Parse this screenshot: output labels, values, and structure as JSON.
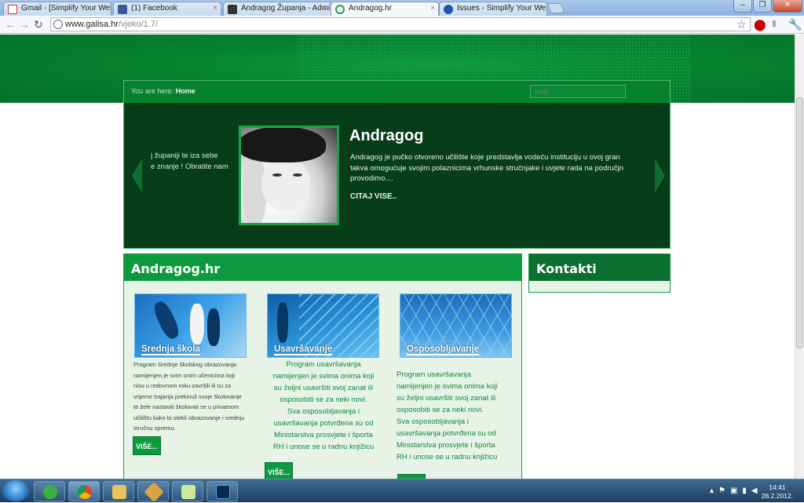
{
  "browser": {
    "tabs": [
      {
        "label": "Gmail - [Simplify Your Web",
        "icon": "gmail-icon",
        "color": "#d93025"
      },
      {
        "label": "(1) Facebook",
        "icon": "facebook-icon",
        "color": "#3b5998"
      },
      {
        "label": "Andragog Županja - Admin",
        "icon": "joomla-icon",
        "color": "#333333"
      },
      {
        "label": "Andragog.hr",
        "icon": "loading-icon",
        "color": "#2e9e4a"
      },
      {
        "label": "Issues - Simplify Your Web",
        "icon": "issues-icon",
        "color": "#1a56b0"
      }
    ],
    "url_domain": "www.galisa.hr",
    "url_path": "/vjeko/1.7/"
  },
  "breadcrumb": {
    "prefix": "You are here:",
    "current": "Home"
  },
  "search": {
    "placeholder": "traži..."
  },
  "slider": {
    "prev_line1": "j županiji te iza sebe",
    "prev_line2": "e znanje ! Obratite nam",
    "title": "Andragog",
    "line1": "Andragog je  pučko otvoreno učilište koje predstavlja vodeću instituciju u ovoj gran",
    "line2": "takva omogućuje svojim polaznicima vrhunske stručnjake i uvjete rada na područjn",
    "line3": "provodimo....",
    "more": "CITAJ VISE.."
  },
  "main_panel": {
    "title": "Andragog.hr",
    "cards": [
      {
        "caption": "Srednja škola",
        "lines": [
          "Program Srednje školskog obrazovanja",
          "namijenjen je svim onim učenicima koji",
          "nisu u redovnom roku završili ili su za",
          "vrijeme trajanja prekinuli svoje školovanje",
          "te žele nastaviti školovati se u privatnom",
          "učilištu kako bi stekli obrazovanje i srednju",
          "stručnu spremu."
        ],
        "button": "VIŠE..."
      },
      {
        "caption": "Usavršavanje",
        "lines": [
          "Program usavršavanja",
          "namijenjen je svima onima koji",
          "su željni usavršiti svoj zanat ili",
          "osposobiti se za neki novi.",
          "Sva osposobljavanja i",
          "usavršavanja potvrđena su od",
          "Ministarstva prosvjete i športa",
          "RH i unose se u radnu knjižicu"
        ],
        "button": "VIŠE..."
      },
      {
        "caption": "Osposobljavanje",
        "lines": [
          "Program usavršavanja",
          "namijenjen je svima onima koji",
          "su željni usavršiti svoj zanat ili",
          "osposobiti se za neki novi.",
          "Sva osposobljavanja i",
          "usavršavanja potvrđena su od",
          "Ministarstva prosvjete i športa",
          "RH i unose se u radnu knjižicu"
        ]
      }
    ]
  },
  "side_panel": {
    "title": "Kontakti"
  },
  "taskbar": {
    "time": "14:41",
    "date": "28.2.2012."
  },
  "colors": {
    "brand_green": "#0d9a3e",
    "dark_green": "#073d19"
  }
}
